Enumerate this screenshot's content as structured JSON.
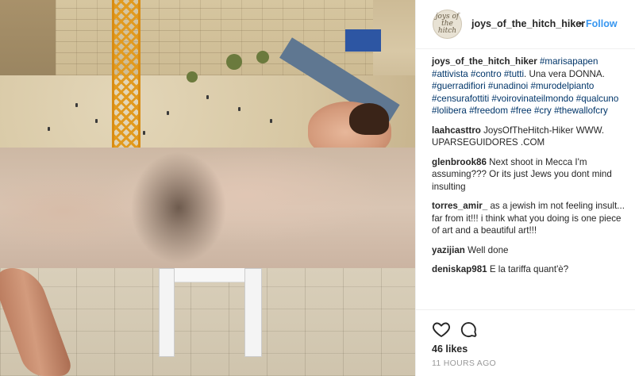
{
  "post": {
    "username": "joys_of_the_hitch_hiker",
    "avatar_text": "joys of the hitch",
    "follow_separator": "•",
    "follow_label": "Follow",
    "caption": {
      "user": "joys_of_the_hitch_hiker",
      "segments": [
        {
          "t": "tag",
          "v": "#marisapapen"
        },
        {
          "t": "tag",
          "v": "#attivista"
        },
        {
          "t": "tag",
          "v": "#contro"
        },
        {
          "t": "tag",
          "v": "#tutti"
        },
        {
          "t": "txt",
          "v": ". Una vera DONNA."
        },
        {
          "t": "tag",
          "v": "#guerradifiori"
        },
        {
          "t": "tag",
          "v": "#unadinoi"
        },
        {
          "t": "tag",
          "v": "#murodelpianto"
        },
        {
          "t": "tag",
          "v": "#censurafottiti"
        },
        {
          "t": "tag",
          "v": "#voirovinateilmondo"
        },
        {
          "t": "tag",
          "v": "#qualcuno"
        },
        {
          "t": "tag",
          "v": "#lolibera"
        },
        {
          "t": "tag",
          "v": "#freedom"
        },
        {
          "t": "tag",
          "v": "#free"
        },
        {
          "t": "tag",
          "v": "#cry"
        },
        {
          "t": "tag",
          "v": "#thewallofcry"
        }
      ]
    },
    "comments": [
      {
        "user": "laahcasttro",
        "text": "JoysOfTheHitch-Hiker WWW. UPARSEGUIDORES .COM"
      },
      {
        "user": "glenbrook86",
        "text": "Next shoot in Mecca I'm assuming??? Or its just Jews you dont mind insulting"
      },
      {
        "user": "torres_amir_",
        "text": "as a jewish im not feeling insult... far from it!!! i think what you doing is one piece of art and a beautiful art!!!"
      },
      {
        "user": "yazijian",
        "text": "Well done"
      },
      {
        "user": "deniskap981",
        "text": "E la tariffa quant'è?"
      }
    ],
    "icons": {
      "like": "heart-icon",
      "comment": "comment-icon"
    },
    "likes": "46 likes",
    "time_ago": "11 HOURS AGO"
  },
  "colors": {
    "link": "#3897f0",
    "hashtag": "#003569",
    "text": "#262626",
    "muted": "#999999"
  }
}
